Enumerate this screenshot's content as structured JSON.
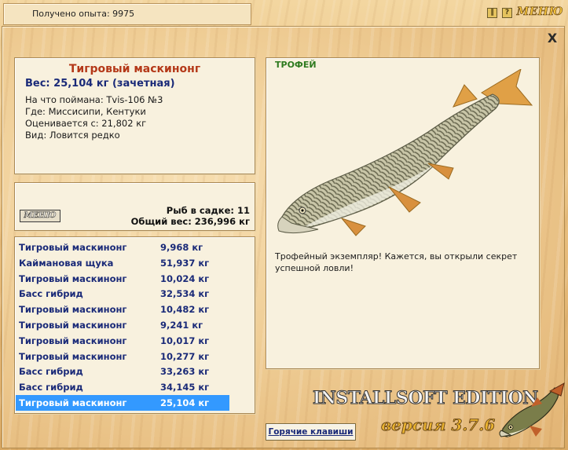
{
  "topbar": {
    "experience": "Получено опыта: 9975",
    "pause_icon": "pause-icon",
    "help_label": "?",
    "menu_label": "МЕНЮ"
  },
  "window": {
    "close_label": "X"
  },
  "fish_info": {
    "title": "Тигровый маскинонг",
    "weight": "Вес: 25,104 кг (зачетная)",
    "bait": "На что поймана: Tvis-106 №3",
    "location": "Где: Миссисипи, Кентуки",
    "value": "Оценивается с: 21,802 кг",
    "rarity": "Вид: Ловится редко"
  },
  "cage": {
    "menu_label": "МЕНЮ",
    "count": "Рыб в садке: 11",
    "total_weight": "Общий вес: 236,996 кг"
  },
  "catch_list": [
    {
      "name": "Тигровый маскинонг",
      "weight": "9,968 кг"
    },
    {
      "name": "Каймановая щука",
      "weight": "51,937 кг"
    },
    {
      "name": "Тигровый маскинонг",
      "weight": "10,024 кг"
    },
    {
      "name": "Басс гибрид",
      "weight": "32,534 кг"
    },
    {
      "name": "Тигровый маскинонг",
      "weight": "10,482 кг"
    },
    {
      "name": "Тигровый маскинонг",
      "weight": "9,241 кг"
    },
    {
      "name": "Тигровый маскинонг",
      "weight": "10,017 кг"
    },
    {
      "name": "Тигровый маскинонг",
      "weight": "10,277 кг"
    },
    {
      "name": "Басс гибрид",
      "weight": "33,263 кг"
    },
    {
      "name": "Басс гибрид",
      "weight": "34,145 кг"
    },
    {
      "name": "Тигровый маскинонг",
      "weight": "25,104 кг"
    }
  ],
  "selected_index": 10,
  "trophy": {
    "label": "ТРОФЕЙ",
    "text": "Трофейный экземпляр! Кажется, вы открыли секрет успешной ловли!"
  },
  "hotkeys_label": "Горячие клавиши",
  "branding": {
    "edition": "INSTALLSOFT EDITION",
    "version": "версия 3.7.6"
  },
  "colors": {
    "title_red": "#b43818",
    "list_blue": "#1a2a78",
    "selection": "#3399ff",
    "trophy_green": "#2e7a1e"
  }
}
